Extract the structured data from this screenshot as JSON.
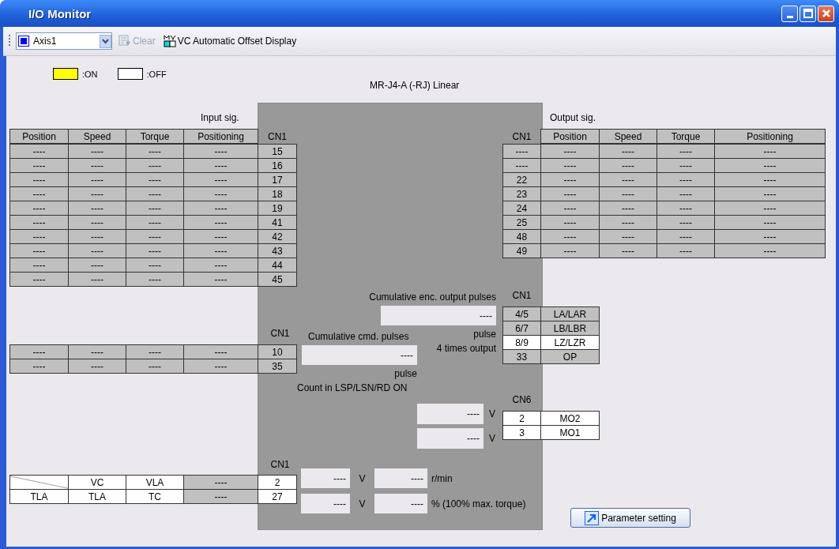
{
  "window": {
    "title": "I/O Monitor"
  },
  "toolbar": {
    "axis": "Axis1",
    "clear": {
      "label": "Clear",
      "disabled": true
    },
    "offset_display": "VC Automatic Offset Display"
  },
  "legend": [
    {
      "label": ":ON",
      "color": "#ffff00"
    },
    {
      "label": ":OFF",
      "color": "#ffffff"
    }
  ],
  "model": "MR-J4-A (-RJ) Linear",
  "input": {
    "label": "Input sig.",
    "connector": "CN1",
    "columns": [
      "Position",
      "Speed",
      "Torque",
      "Positioning"
    ],
    "rows": [
      {
        "values": [
          "----",
          "----",
          "----",
          "----"
        ],
        "pin": "15",
        "enabled": false
      },
      {
        "values": [
          "----",
          "----",
          "----",
          "----"
        ],
        "pin": "16",
        "enabled": false
      },
      {
        "values": [
          "----",
          "----",
          "----",
          "----"
        ],
        "pin": "17",
        "enabled": false
      },
      {
        "values": [
          "----",
          "----",
          "----",
          "----"
        ],
        "pin": "18",
        "enabled": false
      },
      {
        "values": [
          "----",
          "----",
          "----",
          "----"
        ],
        "pin": "19",
        "enabled": false
      },
      {
        "values": [
          "----",
          "----",
          "----",
          "----"
        ],
        "pin": "41",
        "enabled": false
      },
      {
        "values": [
          "----",
          "----",
          "----",
          "----"
        ],
        "pin": "42",
        "enabled": false
      },
      {
        "values": [
          "----",
          "----",
          "----",
          "----"
        ],
        "pin": "43",
        "enabled": false
      },
      {
        "values": [
          "----",
          "----",
          "----",
          "----"
        ],
        "pin": "44",
        "enabled": false
      },
      {
        "values": [
          "----",
          "----",
          "----",
          "----"
        ],
        "pin": "45",
        "enabled": false
      }
    ]
  },
  "input_pulse": {
    "connector": "CN1",
    "rows": [
      {
        "values": [
          "----",
          "----",
          "----",
          "----"
        ],
        "pin": "10",
        "enabled": false
      },
      {
        "values": [
          "----",
          "----",
          "----",
          "----"
        ],
        "pin": "35",
        "enabled": false
      }
    ]
  },
  "analog_input": {
    "connector": "CN1",
    "rows": [
      {
        "cells": [
          {
            "kind": "diagonal",
            "enabled": true
          },
          {
            "text": "VC",
            "enabled": true
          },
          {
            "text": "VLA",
            "enabled": true
          },
          {
            "text": "----",
            "enabled": false
          }
        ],
        "pin": {
          "text": "2",
          "enabled": true
        }
      },
      {
        "cells": [
          {
            "text": "TLA",
            "enabled": true
          },
          {
            "text": "TLA",
            "enabled": true
          },
          {
            "text": "TC",
            "enabled": true
          },
          {
            "text": "----",
            "enabled": false
          }
        ],
        "pin": {
          "text": "27",
          "enabled": true
        }
      }
    ]
  },
  "output": {
    "label": "Output sig.",
    "connector": "CN1",
    "columns": [
      "Position",
      "Speed",
      "Torque",
      "Positioning"
    ],
    "rows": [
      {
        "pin": "----",
        "values": [
          "----",
          "----",
          "----",
          "----"
        ],
        "enabled": false
      },
      {
        "pin": "----",
        "values": [
          "----",
          "----",
          "----",
          "----"
        ],
        "enabled": false
      },
      {
        "pin": "22",
        "values": [
          "----",
          "----",
          "----",
          "----"
        ],
        "enabled": false
      },
      {
        "pin": "23",
        "values": [
          "----",
          "----",
          "----",
          "----"
        ],
        "enabled": false
      },
      {
        "pin": "24",
        "values": [
          "----",
          "----",
          "----",
          "----"
        ],
        "enabled": false
      },
      {
        "pin": "25",
        "values": [
          "----",
          "----",
          "----",
          "----"
        ],
        "enabled": false
      },
      {
        "pin": "48",
        "values": [
          "----",
          "----",
          "----",
          "----"
        ],
        "enabled": false
      },
      {
        "pin": "49",
        "values": [
          "----",
          "----",
          "----",
          "----"
        ],
        "enabled": false
      }
    ]
  },
  "encoder_output": {
    "connector": "CN1",
    "rows": [
      {
        "pin": "4/5",
        "signal": "LA/LAR",
        "enabled": false
      },
      {
        "pin": "6/7",
        "signal": "LB/LBR",
        "enabled": false
      },
      {
        "pin": "8/9",
        "signal": "LZ/LZR",
        "enabled": true
      },
      {
        "pin": "33",
        "signal": "OP",
        "enabled": false
      }
    ]
  },
  "analog_monitor": {
    "connector": "CN6",
    "rows": [
      {
        "pin": "2",
        "signal": "MO2",
        "enabled": true
      },
      {
        "pin": "3",
        "signal": "MO1",
        "enabled": true
      }
    ]
  },
  "enc_pulses": {
    "label": "Cumulative enc. output pulses",
    "value": "----",
    "unit": "pulse",
    "note": "4 times output"
  },
  "cmd_pulses": {
    "label": "Cumulative cmd. pulses",
    "value": "----",
    "unit": "pulse",
    "note": "Count in LSP/LSN/RD ON"
  },
  "monitor_voltages": [
    {
      "value": "----",
      "unit": "V"
    },
    {
      "value": "----",
      "unit": "V"
    }
  ],
  "analog_readings": [
    {
      "voltage": "----",
      "voltage_unit": "V",
      "value": "----",
      "unit": "r/min"
    },
    {
      "voltage": "----",
      "voltage_unit": "V",
      "value": "----",
      "unit": "% (100% max. torque)"
    }
  ],
  "parameter_button": "Parameter setting"
}
